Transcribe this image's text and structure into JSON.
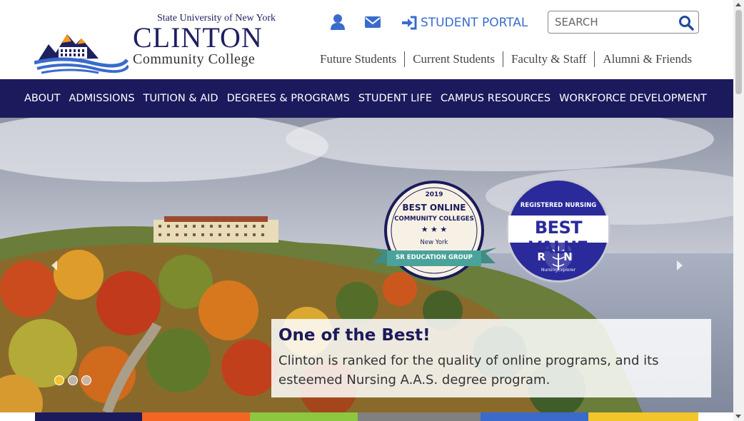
{
  "logo": {
    "line1": "State University of New York",
    "line2": "CLINTON",
    "line3": "Community College"
  },
  "utility": {
    "user_icon": "user-icon",
    "mail_icon": "envelope-icon",
    "portal_label": "STUDENT PORTAL",
    "portal_icon": "sign-in-icon"
  },
  "search": {
    "placeholder": "SEARCH",
    "icon": "search-icon"
  },
  "audience_links": [
    "Future Students",
    "Current Students",
    "Faculty & Staff",
    "Alumni & Friends"
  ],
  "nav": [
    "ABOUT",
    "ADMISSIONS",
    "TUITION & AID",
    "DEGREES & PROGRAMS",
    "STUDENT LIFE",
    "CAMPUS RESOURCES",
    "WORKFORCE DEVELOPMENT"
  ],
  "hero": {
    "title": "One of the Best!",
    "text": "Clinton is ranked for the quality of online programs, and its esteemed Nursing A.A.S. degree program.",
    "prev_label": "Previous",
    "next_label": "Next",
    "active_slide": 1,
    "slide_count": 3
  },
  "badge1": {
    "year": "2019",
    "line1": "BEST ONLINE",
    "line2": "COMMUNITY COLLEGES",
    "state": "New York",
    "ribbon": "SR EDUCATION GROUP"
  },
  "badge2": {
    "top": "REGISTERED NURSING",
    "main": "BEST VALUE",
    "letters": "R N",
    "bottom": "NursingExplorer"
  },
  "colors": {
    "navy": "#1b1a5c",
    "portal_blue": "#3a6bcc",
    "colorbar": [
      "#1b1a5c",
      "#f26522",
      "#8dc63f",
      "#808080",
      "#3a6bcc",
      "#f2c52b"
    ]
  }
}
